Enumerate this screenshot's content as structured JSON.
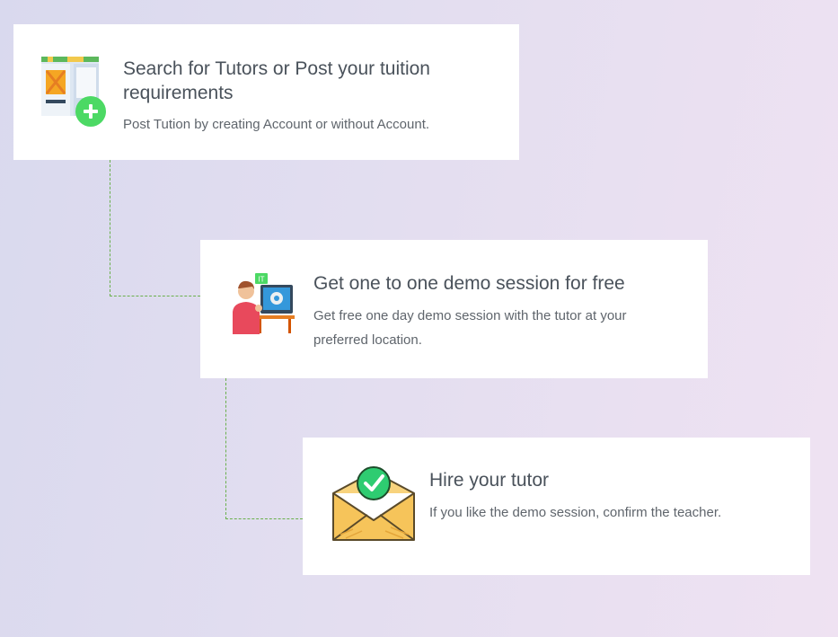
{
  "steps": [
    {
      "title": "Search for Tutors or Post your tuition requirements",
      "description": "Post Tution by creating Account or without Account.",
      "icon": "post-requirement-icon"
    },
    {
      "title": "Get one to one demo session for free",
      "description": "Get free one day demo session with the tutor at your preferred location.",
      "icon": "demo-session-icon",
      "icon_badge": "IT"
    },
    {
      "title": "Hire your tutor",
      "description": "If you like the demo session, confirm the teacher.",
      "icon": "hire-tutor-envelope-icon"
    }
  ],
  "colors": {
    "connector": "#6ab04c",
    "card_background": "#ffffff",
    "title_text": "#4a525b",
    "description_text": "#5f656c",
    "plus_badge": "#4cd964",
    "check_badge": "#2ecc71",
    "envelope": "#f6c45a"
  }
}
